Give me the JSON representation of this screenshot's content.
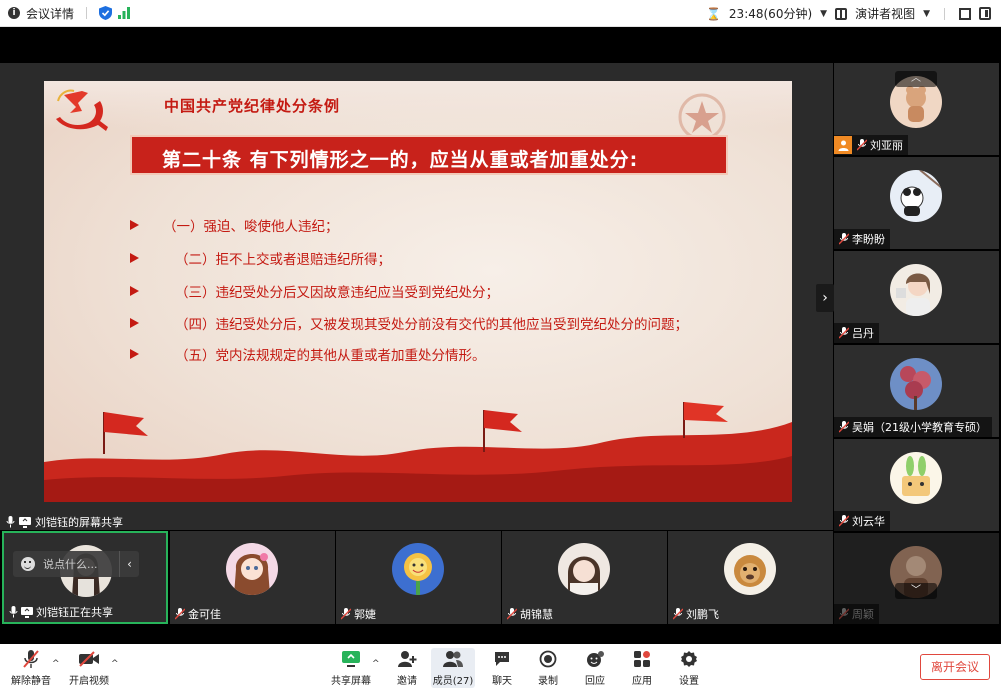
{
  "topbar": {
    "meeting_info": "会议详情",
    "timer": "23:48(60分钟)",
    "view_mode": "演讲者视图"
  },
  "slide": {
    "title": "中国共产党纪律处分条例",
    "article": "第二十条  有下列情形之一的，应当从重或者加重处分:",
    "items": [
      "（一）强迫、唆使他人违纪；",
      "（二）拒不上交或者退赔违纪所得；",
      "（三）违纪受处分后又因故意违纪应当受到党纪处分；",
      "（四）违纪受处分后，又被发现其受处分前没有交代的其他应当受到党纪处分的问题；",
      "（五）党内法规规定的其他从重或者加重处分情形。"
    ]
  },
  "share": {
    "label": "刘铠钰的屏幕共享"
  },
  "gallery": {
    "participants": [
      {
        "name": "刘亚丽"
      },
      {
        "name": "李盼盼"
      },
      {
        "name": "吕丹"
      },
      {
        "name": "吴娟（21级小学教育专硕）"
      },
      {
        "name": "刘云华"
      },
      {
        "name": "周颖"
      }
    ]
  },
  "bottom": {
    "self_label": "刘铠钰正在共享",
    "chat_placeholder": "说点什么...",
    "participants": [
      {
        "name": "金可佳"
      },
      {
        "name": "郭婕"
      },
      {
        "name": "胡锦慧"
      },
      {
        "name": "刘鹏飞"
      }
    ]
  },
  "toolbar": {
    "unmute": "解除静音",
    "start_video": "开启视频",
    "share_screen": "共享屏幕",
    "invite": "邀请",
    "members": "成员(27)",
    "chat": "聊天",
    "record": "录制",
    "reactions": "回应",
    "apps": "应用",
    "settings": "设置",
    "leave": "离开会议"
  },
  "colors": {
    "accent_red": "#c41a12",
    "host_orange": "#f08a24",
    "active_green": "#27b35a",
    "leave_red": "#e0483e"
  }
}
